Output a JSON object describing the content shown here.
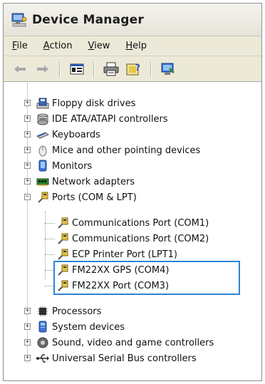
{
  "window": {
    "title": "Device Manager"
  },
  "menu": [
    {
      "first": "F",
      "rest": "ile"
    },
    {
      "first": "A",
      "rest": "ction"
    },
    {
      "first": "V",
      "rest": "iew"
    },
    {
      "first": "H",
      "rest": "elp"
    }
  ],
  "toolbar": {
    "icons": [
      "back-arrow-icon",
      "forward-arrow-icon",
      "properties-icon",
      "print-icon",
      "help-icon",
      "scan-hardware-icon"
    ]
  },
  "tree": {
    "nodes": [
      {
        "label": "Floppy disk drives",
        "icon": "floppy-drive-icon",
        "expander": "+"
      },
      {
        "label": "IDE ATA/ATAPI controllers",
        "icon": "ide-controller-icon",
        "expander": "+"
      },
      {
        "label": "Keyboards",
        "icon": "keyboard-icon",
        "expander": "+"
      },
      {
        "label": "Mice and other pointing devices",
        "icon": "mouse-icon",
        "expander": "+"
      },
      {
        "label": "Monitors",
        "icon": "monitor-icon",
        "expander": "+"
      },
      {
        "label": "Network adapters",
        "icon": "network-adapter-icon",
        "expander": "+"
      },
      {
        "label": "Ports (COM & LPT)",
        "icon": "port-icon",
        "expander": "−"
      },
      {
        "label": "Communications Port (COM1)",
        "icon": "port-icon",
        "child": true
      },
      {
        "label": "Communications Port (COM2)",
        "icon": "port-icon",
        "child": true
      },
      {
        "label": "ECP Printer Port (LPT1)",
        "icon": "port-icon",
        "child": true
      },
      {
        "label": "FM22XX GPS (COM4)",
        "icon": "port-icon",
        "child": true
      },
      {
        "label": "FM22XX Port (COM3)",
        "icon": "port-icon",
        "child": true
      },
      {
        "label": "Processors",
        "icon": "processor-icon",
        "expander": "+"
      },
      {
        "label": "System devices",
        "icon": "system-device-icon",
        "expander": "+"
      },
      {
        "label": "Sound, video and game controllers",
        "icon": "sound-icon",
        "expander": "+"
      },
      {
        "label": "Universal Serial Bus controllers",
        "icon": "usb-icon",
        "expander": "+"
      }
    ]
  },
  "colors": {
    "highlight": "#2f83d6"
  }
}
